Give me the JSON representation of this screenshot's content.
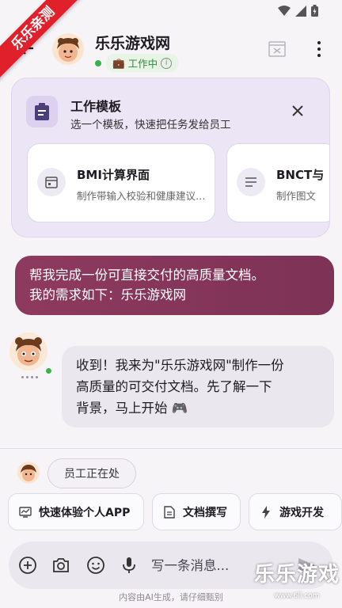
{
  "watermark_ribbon": "乐乐亲测",
  "header": {
    "title": "乐乐游戏网",
    "status_label": "工作中",
    "work_icon": "briefcase-icon"
  },
  "template_panel": {
    "title": "工作模板",
    "subtitle": "选一个模板，快速把任务发给员工",
    "cards": [
      {
        "title": "BMI计算界面",
        "desc": "制作带输入校验和健康建议的界面",
        "icon": "calendar-icon"
      },
      {
        "title": "BNCT与",
        "desc": "制作图文",
        "icon": "document-lines-icon"
      }
    ]
  },
  "messages": {
    "user": [
      "帮我完成一份可直接交付的高质量文档。",
      "我的需求如下：乐乐游戏网"
    ],
    "bot": [
      "收到！我来为\"乐乐游戏网\"制作一份",
      "高质量的可交付文档。先了解一下",
      "背景，马上开始 🎮"
    ]
  },
  "employee_status": "员工正在处",
  "chips": [
    {
      "label": "快速体验个人APP",
      "icon": "chart-monitor-icon"
    },
    {
      "label": "文档撰写",
      "icon": "document-icon"
    },
    {
      "label": "游戏开发",
      "icon": "bolt-icon"
    }
  ],
  "input": {
    "placeholder": "写一条消息..."
  },
  "disclaimer": "内容由AI生成，请仔细甄别",
  "corner_watermark": {
    "big": "乐乐游戏",
    "small": "www.6ll.com"
  },
  "colors": {
    "accent_purple": "#ebe5f6",
    "user_bubble": "#8e3a5e",
    "online_green": "#37b24d",
    "ribbon_red": "#e0202a"
  }
}
